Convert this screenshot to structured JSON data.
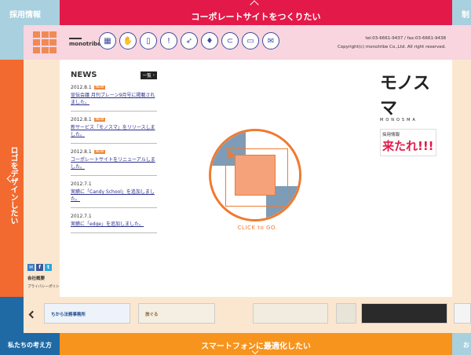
{
  "nav": {
    "top_left": "採用情報",
    "top_center": "コーポレートサイトをつくりたい",
    "top_right": "制",
    "left_side": "ロゴをデザインしたい",
    "bottom_left": "私たちの考え方",
    "bottom_center": "スマートフォンに最適化したい",
    "bottom_right": "お"
  },
  "header": {
    "brand": "monotribe",
    "tel": "tel:03-6661-9437 / fax:03-6661-9438",
    "copyright": "Copyright(c) monotribe Co.,Ltd. All right reserved.",
    "icons": [
      "calculator-icon",
      "hand-icon",
      "tablet-icon",
      "idea-icon",
      "paper-plane-icon",
      "tie-icon",
      "magnet-icon",
      "monitor-icon",
      "mail-icon"
    ]
  },
  "news": {
    "title": "NEWS",
    "all_label": "一覧",
    "new_badge": "NEW",
    "items": [
      {
        "date": "2012.8.1",
        "is_new": true,
        "text": "宣伝会議 月刊ブレーン9月号に掲載されました。"
      },
      {
        "date": "2012.8.1",
        "is_new": true,
        "text": "新サービス「モノスマ」をリリースしました。"
      },
      {
        "date": "2012.8.1",
        "is_new": true,
        "text": "コーポレートサイトをリニューアルしました。"
      },
      {
        "date": "2012.7.1",
        "is_new": false,
        "text": "実績に「Candy School」を追加しました。"
      },
      {
        "date": "2012.7.1",
        "is_new": false,
        "text": "実績に「edge」を追加しました。"
      }
    ]
  },
  "center": {
    "click_label": "CLICK to GO."
  },
  "promo": {
    "logo": "モノスマ",
    "sub": "MONOSMA",
    "recruit_small": "採用情報",
    "recruit_big": "来たれ!!!"
  },
  "left_panel": {
    "sns": [
      "mail",
      "f",
      "t"
    ],
    "company": "会社概要",
    "privacy": "プライバシーポリシー"
  },
  "carousel": {
    "thumbs": [
      "ちから法務事務所",
      "旅ぐる",
      "",
      "",
      "",
      ""
    ]
  },
  "colors": {
    "accent_red": "#e3194a",
    "accent_orange": "#f26a2f",
    "accent_blue": "#1f6aa5",
    "light_blue": "#a8d0de"
  }
}
